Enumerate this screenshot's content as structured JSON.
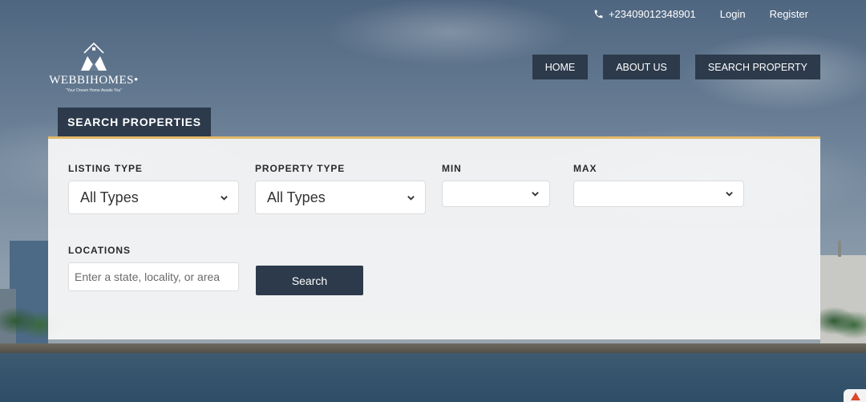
{
  "topbar": {
    "phone": "+23409012348901",
    "login": "Login",
    "register": "Register"
  },
  "logo": {
    "brand": "WEBBIHOMES",
    "tagline": "\"Your Dream Home Awaits You\""
  },
  "nav": {
    "items": [
      {
        "label": "HOME"
      },
      {
        "label": "ABOUT US"
      },
      {
        "label": "SEARCH PROPERTY"
      }
    ]
  },
  "search": {
    "tab_label": "SEARCH PROPERTIES",
    "listing_type": {
      "label": "LISTING TYPE",
      "value": "All Types"
    },
    "property_type": {
      "label": "PROPERTY TYPE",
      "value": "All Types"
    },
    "min": {
      "label": "MIN",
      "value": ""
    },
    "max": {
      "label": "MAX",
      "value": ""
    },
    "locations": {
      "label": "LOCATIONS",
      "placeholder": "Enter a state, locality, or area"
    },
    "button_label": "Search"
  },
  "colors": {
    "dark_navy": "#2c3a4b",
    "accent_gold": "#e3b86a",
    "panel_bg": "#f8f8f8"
  },
  "icons": {
    "phone": "phone-icon",
    "dropdown": "chevron-down-icon",
    "logo": "house-logo-icon"
  }
}
